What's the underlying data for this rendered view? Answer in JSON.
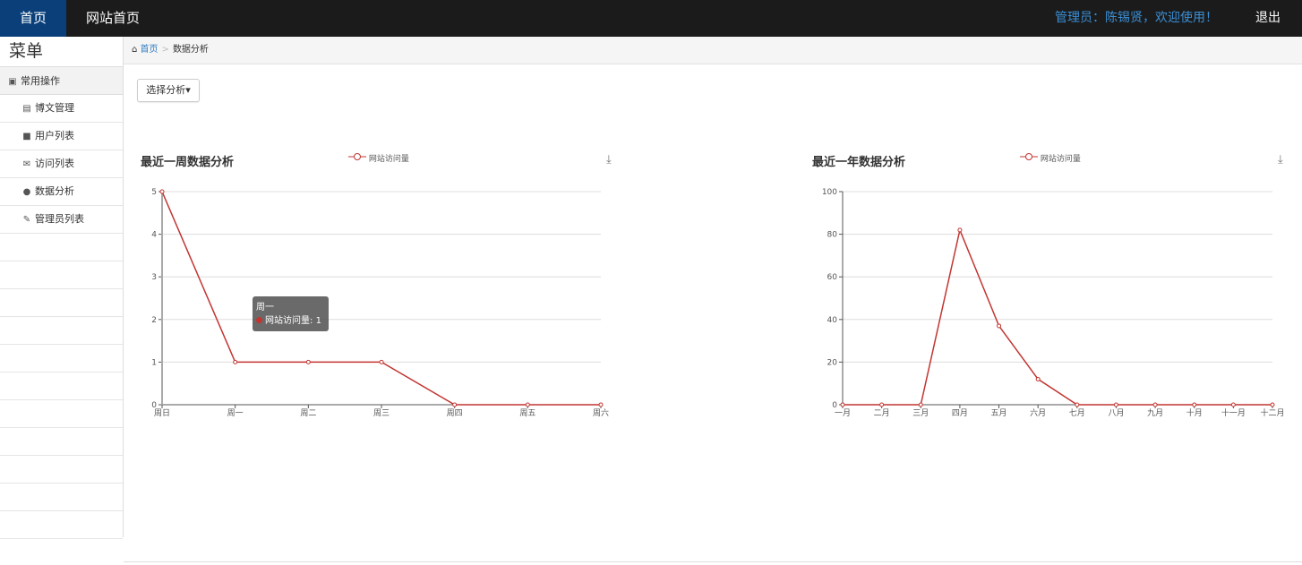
{
  "topbar": {
    "home": "首页",
    "site_home": "网站首页",
    "welcome": "管理员：陈锡贤，欢迎使用！",
    "logout": "退出"
  },
  "sidebar": {
    "title": "菜单",
    "group": "常用操作",
    "items": [
      {
        "label": "博文管理",
        "icon": "list-icon"
      },
      {
        "label": "用户列表",
        "icon": "users-icon"
      },
      {
        "label": "访问列表",
        "icon": "envelope-icon"
      },
      {
        "label": "数据分析",
        "icon": "comment-icon"
      },
      {
        "label": "管理员列表",
        "icon": "wrench-icon"
      }
    ]
  },
  "breadcrumb": {
    "home": "首页",
    "current": "数据分析"
  },
  "dropdown": {
    "label": "选择分析"
  },
  "tooltip": {
    "title": "周一",
    "series": "网站访问量",
    "value": "1"
  },
  "chart_data": [
    {
      "type": "line",
      "title": "最近一周数据分析",
      "categories": [
        "周日",
        "周一",
        "周二",
        "周三",
        "周四",
        "周五",
        "周六"
      ],
      "series": [
        {
          "name": "网站访问量",
          "values": [
            5,
            1,
            1,
            1,
            0,
            0,
            0
          ]
        }
      ],
      "ylim": [
        0,
        5
      ],
      "yticks": [
        0,
        1,
        2,
        3,
        4,
        5
      ],
      "color": "#c23531",
      "legend": "top-center",
      "grid": true
    },
    {
      "type": "line",
      "title": "最近一年数据分析",
      "categories": [
        "一月",
        "二月",
        "三月",
        "四月",
        "五月",
        "六月",
        "七月",
        "八月",
        "九月",
        "十月",
        "十一月",
        "十二月"
      ],
      "series": [
        {
          "name": "网站访问量",
          "values": [
            0,
            0,
            0,
            82,
            37,
            12,
            0,
            0,
            0,
            0,
            0,
            0
          ]
        }
      ],
      "ylim": [
        0,
        100
      ],
      "yticks": [
        0,
        20,
        40,
        60,
        80,
        100
      ],
      "color": "#c23531",
      "legend": "top-center",
      "grid": true
    }
  ]
}
